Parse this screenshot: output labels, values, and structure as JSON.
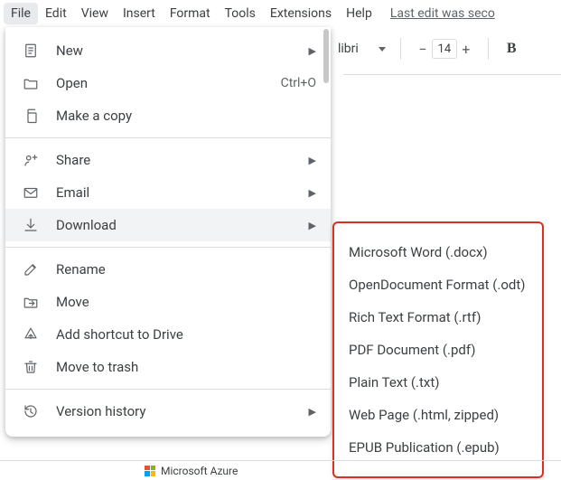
{
  "menubar": {
    "items": [
      "File",
      "Edit",
      "View",
      "Insert",
      "Format",
      "Tools",
      "Extensions",
      "Help"
    ],
    "active_index": 0,
    "last_edit": "Last edit was seco"
  },
  "toolbar": {
    "font_name": "libri",
    "font_size": "14",
    "bold_glyph": "B"
  },
  "file_menu": {
    "items": [
      {
        "icon": "doc-new-icon",
        "label": "New",
        "submenu": true
      },
      {
        "icon": "folder-open-icon",
        "label": "Open",
        "shortcut": "Ctrl+O"
      },
      {
        "icon": "copy-icon",
        "label": "Make a copy"
      },
      {
        "sep": true
      },
      {
        "icon": "share-icon",
        "label": "Share",
        "submenu": true
      },
      {
        "icon": "email-icon",
        "label": "Email",
        "submenu": true
      },
      {
        "icon": "download-icon",
        "label": "Download",
        "submenu": true,
        "highlight": true
      },
      {
        "sep": true
      },
      {
        "icon": "rename-icon",
        "label": "Rename"
      },
      {
        "icon": "move-icon",
        "label": "Move"
      },
      {
        "icon": "drive-shortcut-icon",
        "label": "Add shortcut to Drive"
      },
      {
        "icon": "trash-icon",
        "label": "Move to trash"
      },
      {
        "sep": true
      },
      {
        "icon": "history-icon",
        "label": "Version history",
        "submenu": true
      }
    ]
  },
  "download_submenu": {
    "items": [
      "Microsoft Word (.docx)",
      "OpenDocument Format (.odt)",
      "Rich Text Format (.rtf)",
      "PDF Document (.pdf)",
      "Plain Text (.txt)",
      "Web Page (.html, zipped)",
      "EPUB Publication (.epub)"
    ]
  },
  "taskbar": {
    "item_label": "Microsoft Azure"
  }
}
